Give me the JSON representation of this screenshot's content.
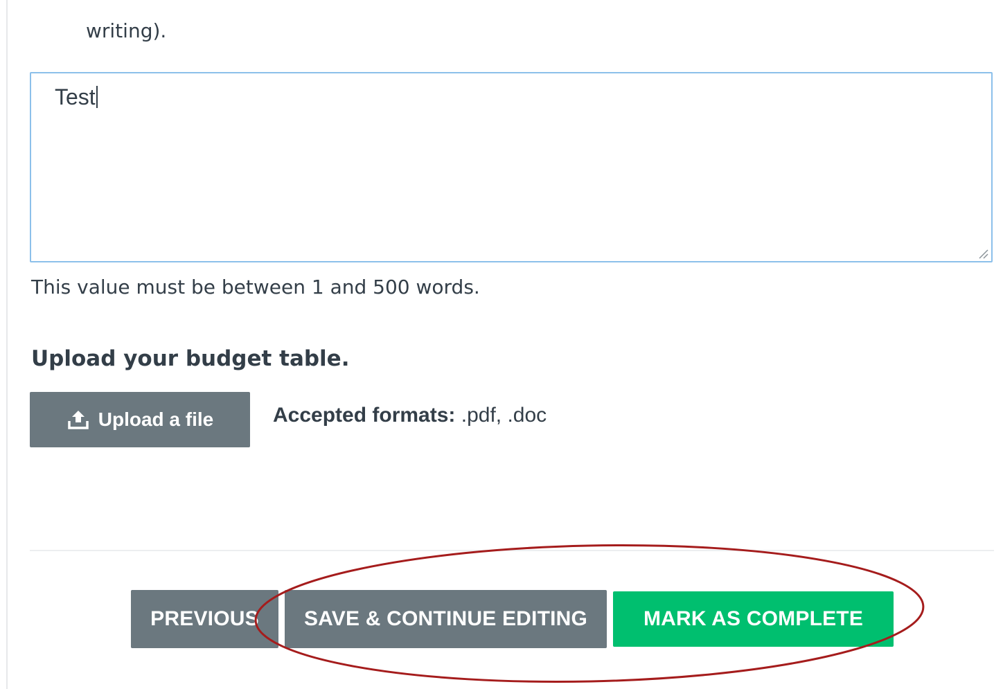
{
  "previous_question": {
    "trailing_text": "writing)."
  },
  "answer": {
    "value": "Test"
  },
  "validation_hint": "This value must be between 1 and 500 words.",
  "upload_question": {
    "title": "Upload your budget table.",
    "button_label": "Upload a file",
    "button_icon": "upload-icon",
    "formats_label": "Accepted formats:",
    "formats_value": " .pdf, .doc"
  },
  "footer": {
    "previous_label": "PREVIOUS",
    "save_label": "SAVE & CONTINUE EDITING",
    "complete_label": "MARK AS COMPLETE"
  },
  "colors": {
    "text": "#333e48",
    "neutral_button": "#6b787f",
    "complete_button": "#00bf6f",
    "focus_border": "#8cc0ea",
    "annotation_ellipse": "#a51c1c"
  }
}
